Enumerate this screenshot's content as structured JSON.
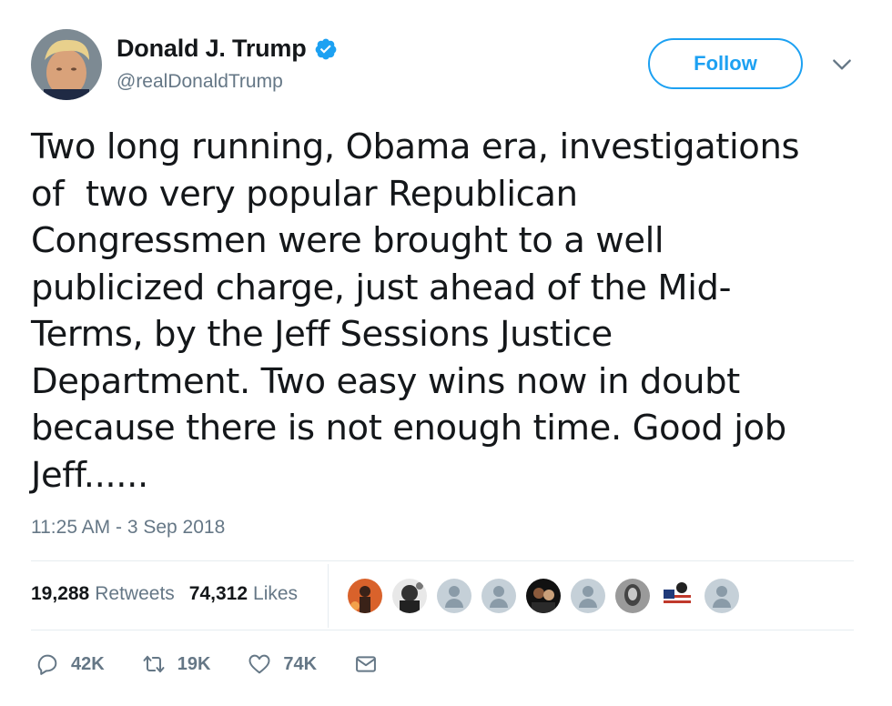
{
  "author": {
    "name": "Donald J. Trump",
    "handle": "@realDonaldTrump",
    "verified": true
  },
  "header": {
    "follow_label": "Follow"
  },
  "tweet": {
    "text": "Two long running, Obama era, investigations\nof  two very popular Republican\nCongressmen were brought to a well\npublicized charge, just ahead of the Mid-\nTerms, by the Jeff Sessions Justice\nDepartment. Two easy wins now in doubt\nbecause there is not enough time. Good job\nJeff......",
    "timestamp": "11:25 AM - 3 Sep 2018"
  },
  "stats": {
    "retweets_count": "19,288",
    "retweets_label": "Retweets",
    "likes_count": "74,312",
    "likes_label": "Likes"
  },
  "actions": {
    "reply_count": "42K",
    "retweet_count": "19K",
    "like_count": "74K"
  },
  "colors": {
    "accent": "#1da1f2",
    "muted": "#657786",
    "text": "#14171a",
    "divider": "#e6ecf0"
  }
}
